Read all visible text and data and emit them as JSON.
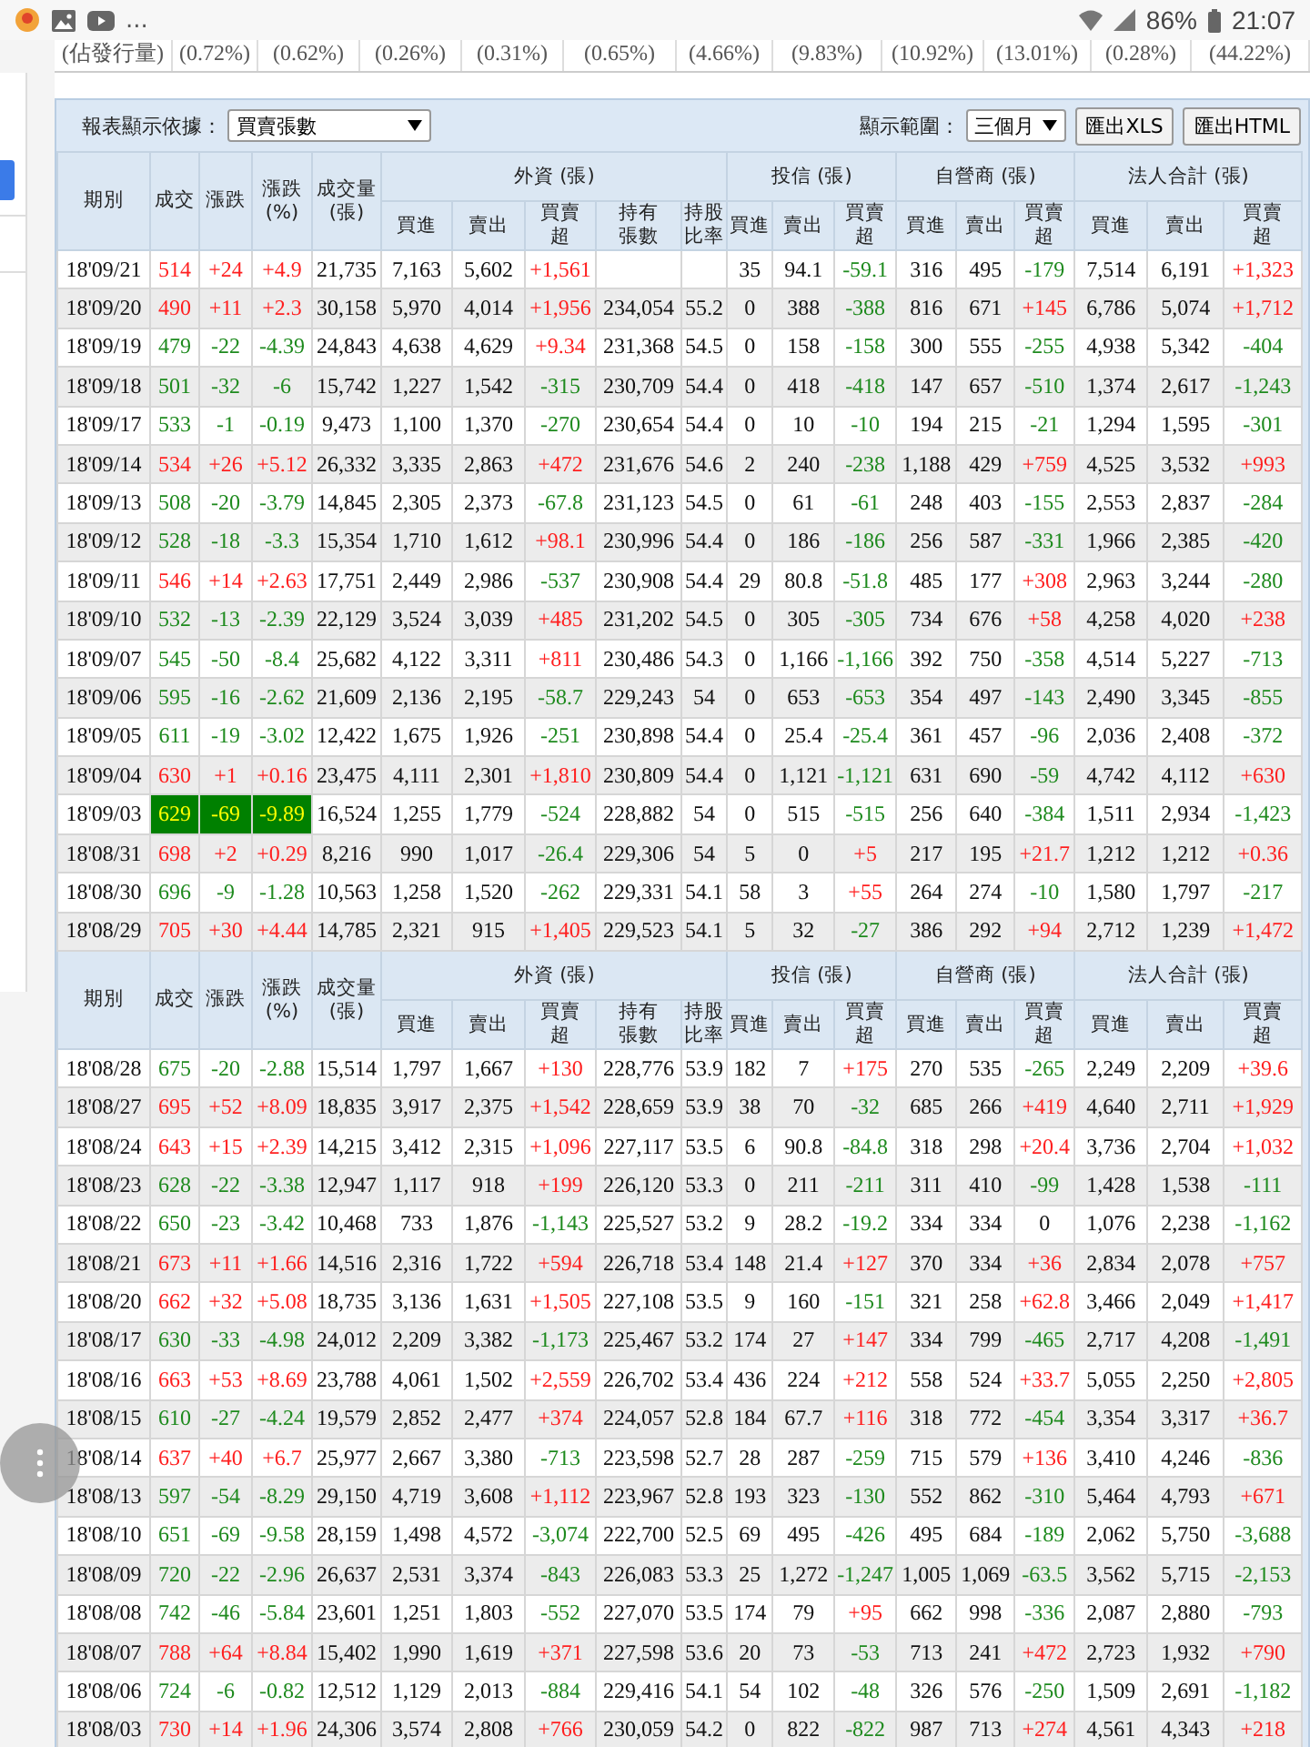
{
  "status_bar": {
    "overflow": "...",
    "battery": "86%",
    "time": "21:07"
  },
  "top_ratio_row": {
    "label": "(佔發行量)",
    "values": [
      "(0.72%)",
      "(0.62%)",
      "(0.26%)",
      "(0.31%)",
      "(0.65%)",
      "(4.66%)",
      "(9.83%)",
      "(10.92%)",
      "(13.01%)",
      "(0.28%)",
      "(44.22%)"
    ]
  },
  "toolbar": {
    "basis_label": "報表顯示依據：",
    "basis_select": "買賣張數",
    "range_label": "顯示範圍：",
    "range_select": "三個月",
    "buttons": [
      "匯出XLS",
      "匯出HTML"
    ]
  },
  "table": {
    "sections": [
      {
        "header": {
          "single": [
            "期別",
            "成交",
            "漲跌",
            "漲跌\n(%)",
            "成交量\n(張)"
          ],
          "groups": [
            {
              "label": "外資 (張)",
              "columns": [
                "買進",
                "賣出",
                "買賣超",
                "持有張數",
                "持股比率"
              ]
            },
            {
              "label": "投信 (張)",
              "columns": [
                "買進",
                "賣出",
                "買賣超"
              ]
            },
            {
              "label": "自營商 (張)",
              "columns": [
                "買進",
                "賣出",
                "買賣超"
              ]
            },
            {
              "label": "法人合計 (張)",
              "columns": [
                "買進",
                "賣出",
                "買賣超"
              ]
            }
          ]
        },
        "rows": [
          {
            "period": "18'09/21",
            "limit_down": false,
            "values": [
              "514",
              "+24",
              "+4.9",
              "21,735",
              "7,163",
              "5,602",
              "+1,561",
              "35",
              "94.1",
              "-59.1",
              "316",
              "495",
              "-179",
              "7,514",
              "6,191",
              "+1,323"
            ]
          },
          {
            "period": "18'09/20",
            "limit_down": false,
            "holding": "234,054",
            "ratio": "55.2",
            "values": [
              "490",
              "+11",
              "+2.3",
              "30,158",
              "5,970",
              "4,014",
              "+1,956",
              "0",
              "388",
              "-388",
              "816",
              "671",
              "+145",
              "6,786",
              "5,074",
              "+1,712"
            ]
          },
          {
            "period": "18'09/19",
            "limit_down": false,
            "holding": "231,368",
            "ratio": "54.5",
            "values": [
              "479",
              "-22",
              "-4.39",
              "24,843",
              "4,638",
              "4,629",
              "+9.34",
              "0",
              "158",
              "-158",
              "300",
              "555",
              "-255",
              "4,938",
              "5,342",
              "-404"
            ]
          },
          {
            "period": "18'09/18",
            "limit_down": false,
            "holding": "230,709",
            "ratio": "54.4",
            "values": [
              "501",
              "-32",
              "-6",
              "15,742",
              "1,227",
              "1,542",
              "-315",
              "0",
              "418",
              "-418",
              "147",
              "657",
              "-510",
              "1,374",
              "2,617",
              "-1,243"
            ]
          },
          {
            "period": "18'09/17",
            "limit_down": false,
            "holding": "230,654",
            "ratio": "54.4",
            "values": [
              "533",
              "-1",
              "-0.19",
              "9,473",
              "1,100",
              "1,370",
              "-270",
              "0",
              "10",
              "-10",
              "194",
              "215",
              "-21",
              "1,294",
              "1,595",
              "-301"
            ]
          },
          {
            "period": "18'09/14",
            "limit_down": false,
            "holding": "231,676",
            "ratio": "54.6",
            "values": [
              "534",
              "+26",
              "+5.12",
              "26,332",
              "3,335",
              "2,863",
              "+472",
              "2",
              "240",
              "-238",
              "1,188",
              "429",
              "+759",
              "4,525",
              "3,532",
              "+993"
            ]
          },
          {
            "period": "18'09/13",
            "limit_down": false,
            "holding": "231,123",
            "ratio": "54.5",
            "values": [
              "508",
              "-20",
              "-3.79",
              "14,845",
              "2,305",
              "2,373",
              "-67.8",
              "0",
              "61",
              "-61",
              "248",
              "403",
              "-155",
              "2,553",
              "2,837",
              "-284"
            ]
          },
          {
            "period": "18'09/12",
            "limit_down": false,
            "holding": "230,996",
            "ratio": "54.4",
            "values": [
              "528",
              "-18",
              "-3.3",
              "15,354",
              "1,710",
              "1,612",
              "+98.1",
              "0",
              "186",
              "-186",
              "256",
              "587",
              "-331",
              "1,966",
              "2,385",
              "-420"
            ]
          },
          {
            "period": "18'09/11",
            "limit_down": false,
            "holding": "230,908",
            "ratio": "54.4",
            "values": [
              "546",
              "+14",
              "+2.63",
              "17,751",
              "2,449",
              "2,986",
              "-537",
              "29",
              "80.8",
              "-51.8",
              "485",
              "177",
              "+308",
              "2,963",
              "3,244",
              "-280"
            ]
          },
          {
            "period": "18'09/10",
            "limit_down": false,
            "holding": "231,202",
            "ratio": "54.5",
            "values": [
              "532",
              "-13",
              "-2.39",
              "22,129",
              "3,524",
              "3,039",
              "+485",
              "0",
              "305",
              "-305",
              "734",
              "676",
              "+58",
              "4,258",
              "4,020",
              "+238"
            ]
          },
          {
            "period": "18'09/07",
            "limit_down": false,
            "holding": "230,486",
            "ratio": "54.3",
            "values": [
              "545",
              "-50",
              "-8.4",
              "25,682",
              "4,122",
              "3,311",
              "+811",
              "0",
              "1,166",
              "-1,166",
              "392",
              "750",
              "-358",
              "4,514",
              "5,227",
              "-713"
            ]
          },
          {
            "period": "18'09/06",
            "limit_down": false,
            "holding": "229,243",
            "ratio": "54",
            "values": [
              "595",
              "-16",
              "-2.62",
              "21,609",
              "2,136",
              "2,195",
              "-58.7",
              "0",
              "653",
              "-653",
              "354",
              "497",
              "-143",
              "2,490",
              "3,345",
              "-855"
            ]
          },
          {
            "period": "18'09/05",
            "limit_down": false,
            "holding": "230,898",
            "ratio": "54.4",
            "values": [
              "611",
              "-19",
              "-3.02",
              "12,422",
              "1,675",
              "1,926",
              "-251",
              "0",
              "25.4",
              "-25.4",
              "361",
              "457",
              "-96",
              "2,036",
              "2,408",
              "-372"
            ]
          },
          {
            "period": "18'09/04",
            "limit_down": false,
            "holding": "230,809",
            "ratio": "54.4",
            "values": [
              "630",
              "+1",
              "+0.16",
              "23,475",
              "4,111",
              "2,301",
              "+1,810",
              "0",
              "1,121",
              "-1,121",
              "631",
              "690",
              "-59",
              "4,742",
              "4,112",
              "+630"
            ]
          },
          {
            "period": "18'09/03",
            "limit_down": true,
            "holding": "228,882",
            "ratio": "54",
            "values": [
              "629",
              "-69",
              "-9.89",
              "16,524",
              "1,255",
              "1,779",
              "-524",
              "0",
              "515",
              "-515",
              "256",
              "640",
              "-384",
              "1,511",
              "2,934",
              "-1,423"
            ]
          },
          {
            "period": "18'08/31",
            "limit_down": false,
            "holding": "229,306",
            "ratio": "54",
            "values": [
              "698",
              "+2",
              "+0.29",
              "8,216",
              "990",
              "1,017",
              "-26.4",
              "5",
              "0",
              "+5",
              "217",
              "195",
              "+21.7",
              "1,212",
              "1,212",
              "+0.36"
            ]
          },
          {
            "period": "18'08/30",
            "limit_down": false,
            "holding": "229,331",
            "ratio": "54.1",
            "values": [
              "696",
              "-9",
              "-1.28",
              "10,563",
              "1,258",
              "1,520",
              "-262",
              "58",
              "3",
              "+55",
              "264",
              "274",
              "-10",
              "1,580",
              "1,797",
              "-217"
            ]
          },
          {
            "period": "18'08/29",
            "limit_down": false,
            "holding": "229,523",
            "ratio": "54.1",
            "values": [
              "705",
              "+30",
              "+4.44",
              "14,785",
              "2,321",
              "915",
              "+1,405",
              "5",
              "32",
              "-27",
              "386",
              "292",
              "+94",
              "2,712",
              "1,239",
              "+1,472"
            ]
          }
        ]
      },
      {
        "header": {
          "single": [
            "期別",
            "成交",
            "漲跌",
            "漲跌\n(%)",
            "成交量\n(張)"
          ],
          "groups": [
            {
              "label": "外資 (張)",
              "columns": [
                "買進",
                "賣出",
                "買賣超",
                "持有張數",
                "持股比率"
              ]
            },
            {
              "label": "投信 (張)",
              "columns": [
                "買進",
                "賣出",
                "買賣超"
              ]
            },
            {
              "label": "自營商 (張)",
              "columns": [
                "買進",
                "賣出",
                "買賣超"
              ]
            },
            {
              "label": "法人合計 (張)",
              "columns": [
                "買進",
                "賣出",
                "買賣超"
              ]
            }
          ]
        },
        "rows": [
          {
            "period": "18'08/28",
            "limit_down": false,
            "holding": "228,776",
            "ratio": "53.9",
            "values": [
              "675",
              "-20",
              "-2.88",
              "15,514",
              "1,797",
              "1,667",
              "+130",
              "182",
              "7",
              "+175",
              "270",
              "535",
              "-265",
              "2,249",
              "2,209",
              "+39.6"
            ]
          },
          {
            "period": "18'08/27",
            "limit_down": false,
            "holding": "228,659",
            "ratio": "53.9",
            "values": [
              "695",
              "+52",
              "+8.09",
              "18,835",
              "3,917",
              "2,375",
              "+1,542",
              "38",
              "70",
              "-32",
              "685",
              "266",
              "+419",
              "4,640",
              "2,711",
              "+1,929"
            ]
          },
          {
            "period": "18'08/24",
            "limit_down": false,
            "holding": "227,117",
            "ratio": "53.5",
            "values": [
              "643",
              "+15",
              "+2.39",
              "14,215",
              "3,412",
              "2,315",
              "+1,096",
              "6",
              "90.8",
              "-84.8",
              "318",
              "298",
              "+20.4",
              "3,736",
              "2,704",
              "+1,032"
            ]
          },
          {
            "period": "18'08/23",
            "limit_down": false,
            "holding": "226,120",
            "ratio": "53.3",
            "values": [
              "628",
              "-22",
              "-3.38",
              "12,947",
              "1,117",
              "918",
              "+199",
              "0",
              "211",
              "-211",
              "311",
              "410",
              "-99",
              "1,428",
              "1,538",
              "-111"
            ]
          },
          {
            "period": "18'08/22",
            "limit_down": false,
            "holding": "225,527",
            "ratio": "53.2",
            "values": [
              "650",
              "-23",
              "-3.42",
              "10,468",
              "733",
              "1,876",
              "-1,143",
              "9",
              "28.2",
              "-19.2",
              "334",
              "334",
              "0",
              "1,076",
              "2,238",
              "-1,162"
            ]
          },
          {
            "period": "18'08/21",
            "limit_down": false,
            "holding": "226,718",
            "ratio": "53.4",
            "values": [
              "673",
              "+11",
              "+1.66",
              "14,516",
              "2,316",
              "1,722",
              "+594",
              "148",
              "21.4",
              "+127",
              "370",
              "334",
              "+36",
              "2,834",
              "2,078",
              "+757"
            ]
          },
          {
            "period": "18'08/20",
            "limit_down": false,
            "holding": "227,108",
            "ratio": "53.5",
            "values": [
              "662",
              "+32",
              "+5.08",
              "18,735",
              "3,136",
              "1,631",
              "+1,505",
              "9",
              "160",
              "-151",
              "321",
              "258",
              "+62.8",
              "3,466",
              "2,049",
              "+1,417"
            ]
          },
          {
            "period": "18'08/17",
            "limit_down": false,
            "holding": "225,467",
            "ratio": "53.2",
            "values": [
              "630",
              "-33",
              "-4.98",
              "24,012",
              "2,209",
              "3,382",
              "-1,173",
              "174",
              "27",
              "+147",
              "334",
              "799",
              "-465",
              "2,717",
              "4,208",
              "-1,491"
            ]
          },
          {
            "period": "18'08/16",
            "limit_down": false,
            "holding": "226,702",
            "ratio": "53.4",
            "values": [
              "663",
              "+53",
              "+8.69",
              "23,788",
              "4,061",
              "1,502",
              "+2,559",
              "436",
              "224",
              "+212",
              "558",
              "524",
              "+33.7",
              "5,055",
              "2,250",
              "+2,805"
            ]
          },
          {
            "period": "18'08/15",
            "limit_down": false,
            "holding": "224,057",
            "ratio": "52.8",
            "values": [
              "610",
              "-27",
              "-4.24",
              "19,579",
              "2,852",
              "2,477",
              "+374",
              "184",
              "67.7",
              "+116",
              "318",
              "772",
              "-454",
              "3,354",
              "3,317",
              "+36.7"
            ]
          },
          {
            "period": "18'08/14",
            "limit_down": false,
            "holding": "223,598",
            "ratio": "52.7",
            "values": [
              "637",
              "+40",
              "+6.7",
              "25,977",
              "2,667",
              "3,380",
              "-713",
              "28",
              "287",
              "-259",
              "715",
              "579",
              "+136",
              "3,410",
              "4,246",
              "-836"
            ]
          },
          {
            "period": "18'08/13",
            "limit_down": false,
            "holding": "223,967",
            "ratio": "52.8",
            "values": [
              "597",
              "-54",
              "-8.29",
              "29,150",
              "4,719",
              "3,608",
              "+1,112",
              "193",
              "323",
              "-130",
              "552",
              "862",
              "-310",
              "5,464",
              "4,793",
              "+671"
            ]
          },
          {
            "period": "18'08/10",
            "limit_down": false,
            "holding": "222,700",
            "ratio": "52.5",
            "values": [
              "651",
              "-69",
              "-9.58",
              "28,159",
              "1,498",
              "4,572",
              "-3,074",
              "69",
              "495",
              "-426",
              "495",
              "684",
              "-189",
              "2,062",
              "5,750",
              "-3,688"
            ]
          },
          {
            "period": "18'08/09",
            "limit_down": false,
            "holding": "226,083",
            "ratio": "53.3",
            "values": [
              "720",
              "-22",
              "-2.96",
              "26,637",
              "2,531",
              "3,374",
              "-843",
              "25",
              "1,272",
              "-1,247",
              "1,005",
              "1,069",
              "-63.5",
              "3,562",
              "5,715",
              "-2,153"
            ]
          },
          {
            "period": "18'08/08",
            "limit_down": false,
            "holding": "227,070",
            "ratio": "53.5",
            "values": [
              "742",
              "-46",
              "-5.84",
              "23,601",
              "1,251",
              "1,803",
              "-552",
              "174",
              "79",
              "+95",
              "662",
              "998",
              "-336",
              "2,087",
              "2,880",
              "-793"
            ]
          },
          {
            "period": "18'08/07",
            "limit_down": false,
            "holding": "227,598",
            "ratio": "53.6",
            "values": [
              "788",
              "+64",
              "+8.84",
              "15,402",
              "1,990",
              "1,619",
              "+371",
              "20",
              "73",
              "-53",
              "713",
              "241",
              "+472",
              "2,723",
              "1,932",
              "+790"
            ]
          },
          {
            "period": "18'08/06",
            "limit_down": false,
            "holding": "229,416",
            "ratio": "54.1",
            "values": [
              "724",
              "-6",
              "-0.82",
              "12,512",
              "1,129",
              "2,013",
              "-884",
              "54",
              "102",
              "-48",
              "326",
              "576",
              "-250",
              "1,509",
              "2,691",
              "-1,182"
            ]
          },
          {
            "period": "18'08/03",
            "limit_down": false,
            "holding": "230,059",
            "ratio": "54.2",
            "values": [
              "730",
              "+14",
              "+1.96",
              "24,306",
              "3,574",
              "2,808",
              "+766",
              "0",
              "822",
              "-822",
              "987",
              "713",
              "+274",
              "4,561",
              "4,343",
              "+218"
            ]
          }
        ]
      }
    ]
  }
}
